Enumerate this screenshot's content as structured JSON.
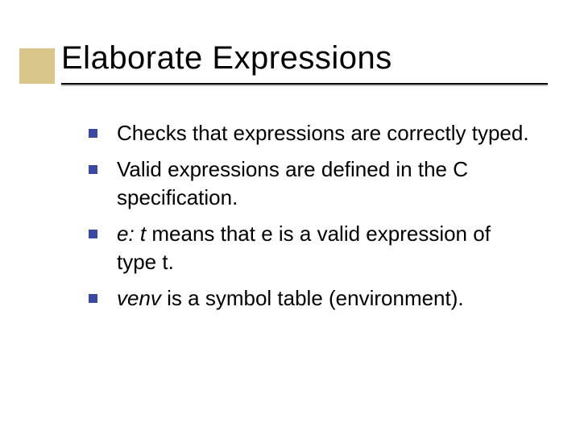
{
  "slide": {
    "title": "Elaborate Expressions",
    "bullets": [
      {
        "text": "Checks that expressions are correctly typed."
      },
      {
        "text": "Valid expressions are defined in the C specification."
      },
      {
        "pre_italic": "e: t",
        "post": " means that e is a valid expression of type t."
      },
      {
        "pre_italic": "venv",
        "post": " is a symbol table (environment)."
      }
    ]
  }
}
